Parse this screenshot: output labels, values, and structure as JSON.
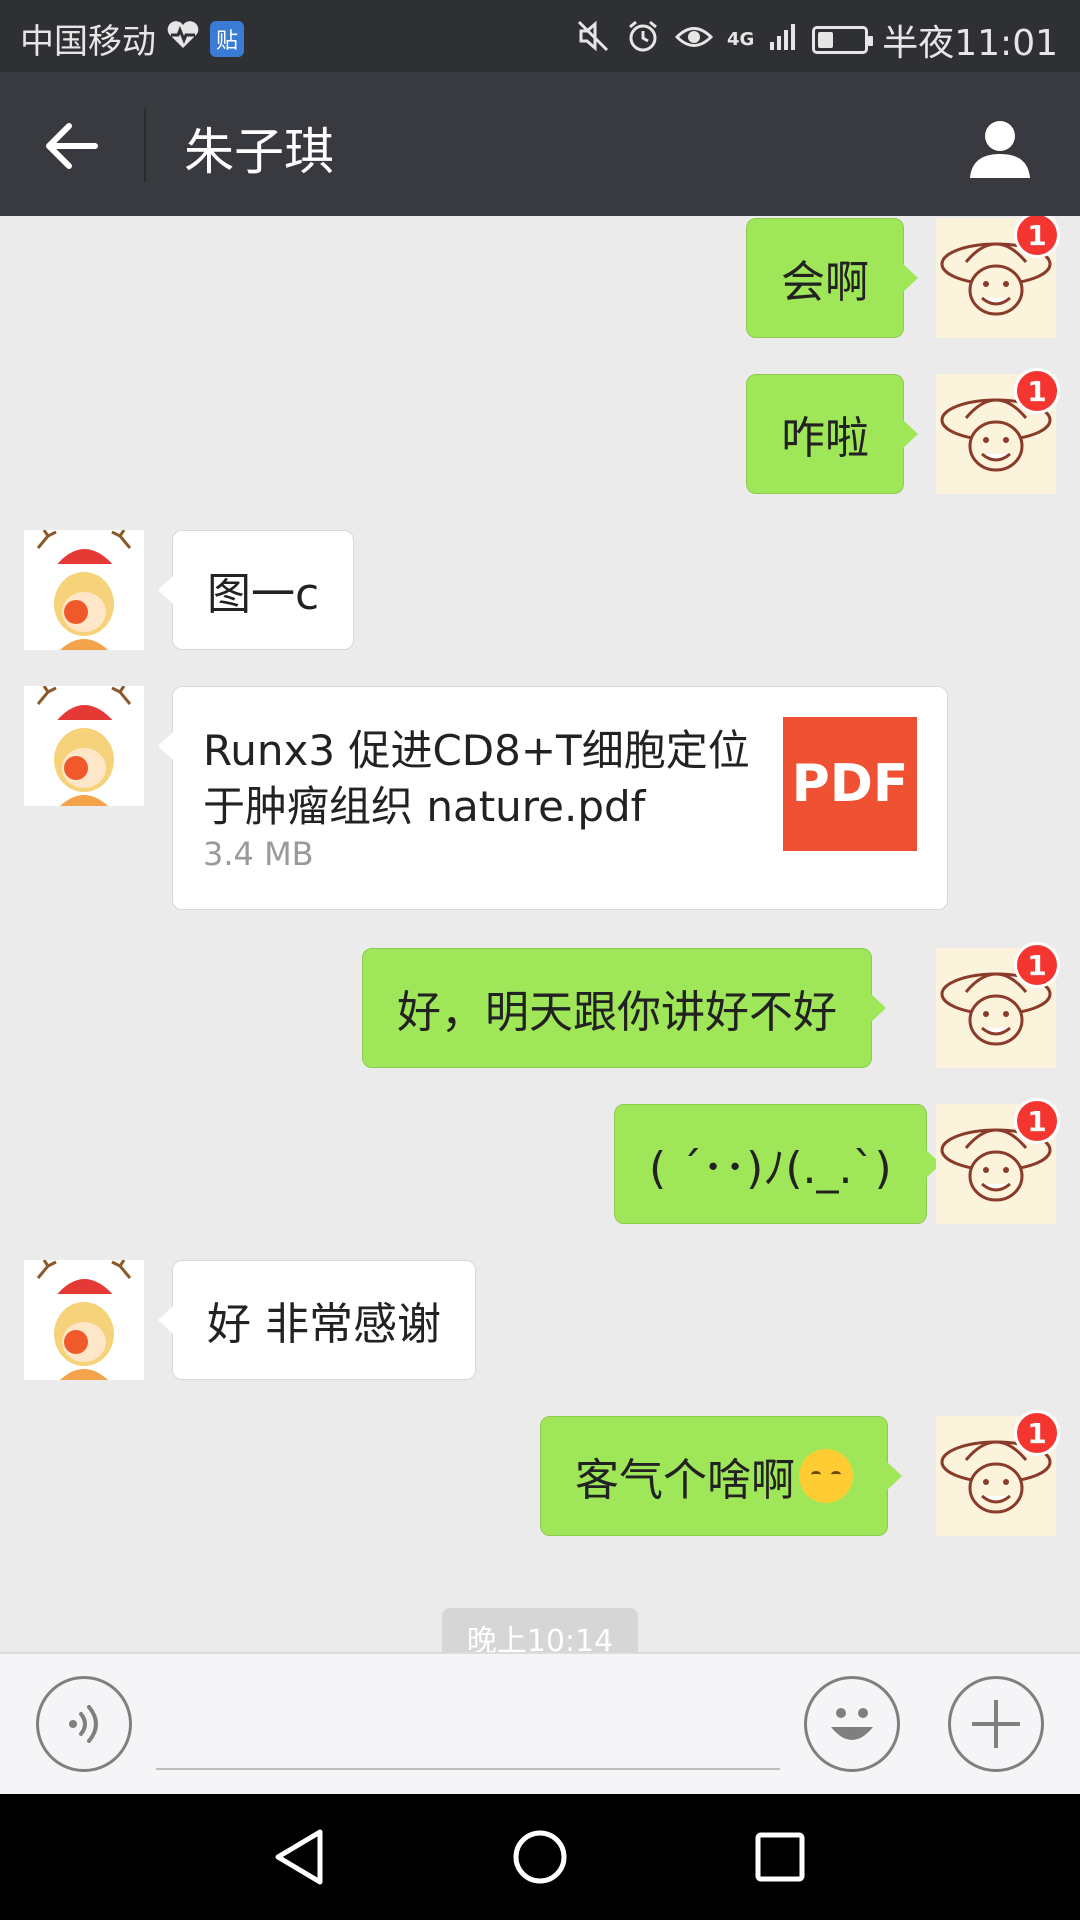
{
  "status_bar": {
    "carrier": "中国移动",
    "app_icon_text": "贴",
    "network": "4G",
    "time": "半夜11:01",
    "battery_level": 0.35,
    "icons": [
      "heart-monitor-icon",
      "mute-icon",
      "alarm-icon",
      "eye-icon",
      "signal-icon",
      "battery-icon"
    ]
  },
  "header": {
    "title": "朱子琪",
    "back_icon": "back-arrow-icon",
    "profile_icon": "person-icon"
  },
  "messages": [
    {
      "from": "me",
      "text": "会啊",
      "badge": "1"
    },
    {
      "from": "me",
      "text": "咋啦",
      "badge": "1"
    },
    {
      "from": "peer",
      "text": "图一c"
    },
    {
      "from": "peer",
      "type": "file",
      "file_name": "Runx3 促进CD8+T细胞定位于肿瘤组织 nature.pdf",
      "file_size": "3.4 MB",
      "file_icon_label": "PDF"
    },
    {
      "from": "me",
      "text": "好，明天跟你讲好不好",
      "badge": "1"
    },
    {
      "from": "me",
      "text": "( ´･･)ﾉ(._.`)",
      "badge": "1"
    },
    {
      "from": "peer",
      "text": "好 非常感谢"
    },
    {
      "from": "me",
      "text": "客气个啥啊",
      "emoji": "smiling-face-icon",
      "badge": "1"
    }
  ],
  "timestamp": "晚上10:14",
  "input_bar": {
    "placeholder": "",
    "icons": [
      "voice-icon",
      "emoji-face-icon",
      "plus-icon"
    ]
  },
  "nav_bar": {
    "icons": [
      "back-triangle-icon",
      "home-circle-icon",
      "recents-square-icon"
    ]
  },
  "colors": {
    "my_bubble": "#9fe658",
    "peer_bubble": "#ffffff",
    "badge": "#f43530",
    "pdf": "#f05133",
    "title_bar": "#393a3f"
  }
}
